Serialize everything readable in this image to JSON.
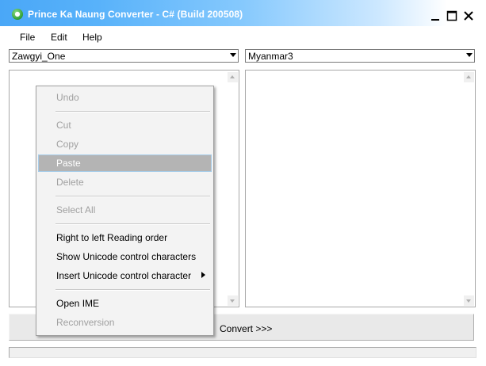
{
  "window": {
    "title": "Prince Ka Naung Converter - C# (Build 200508)",
    "icon": "app-logo-icon",
    "controls": [
      "minimize-icon",
      "maximize-icon",
      "close-icon"
    ]
  },
  "menu": {
    "file": "File",
    "edit": "Edit",
    "help": "Help"
  },
  "source": {
    "font": "Zawgyi_One"
  },
  "target": {
    "font": "Myanmar3"
  },
  "convert_label": "Convert >>>",
  "context_menu": {
    "undo": "Undo",
    "cut": "Cut",
    "copy": "Copy",
    "paste": "Paste",
    "delete": "Delete",
    "select_all": "Select All",
    "rtl": "Right to left Reading order",
    "show_unicode": "Show Unicode control characters",
    "insert_unicode": "Insert Unicode control character",
    "open_ime": "Open IME",
    "reconversion": "Reconversion"
  },
  "colors": {
    "titlebar_start": "#4aa7f7",
    "titlebar_end": "#ffffff",
    "menu_highlight": "#b4b4b4",
    "disabled_text": "#a0a0a0"
  }
}
